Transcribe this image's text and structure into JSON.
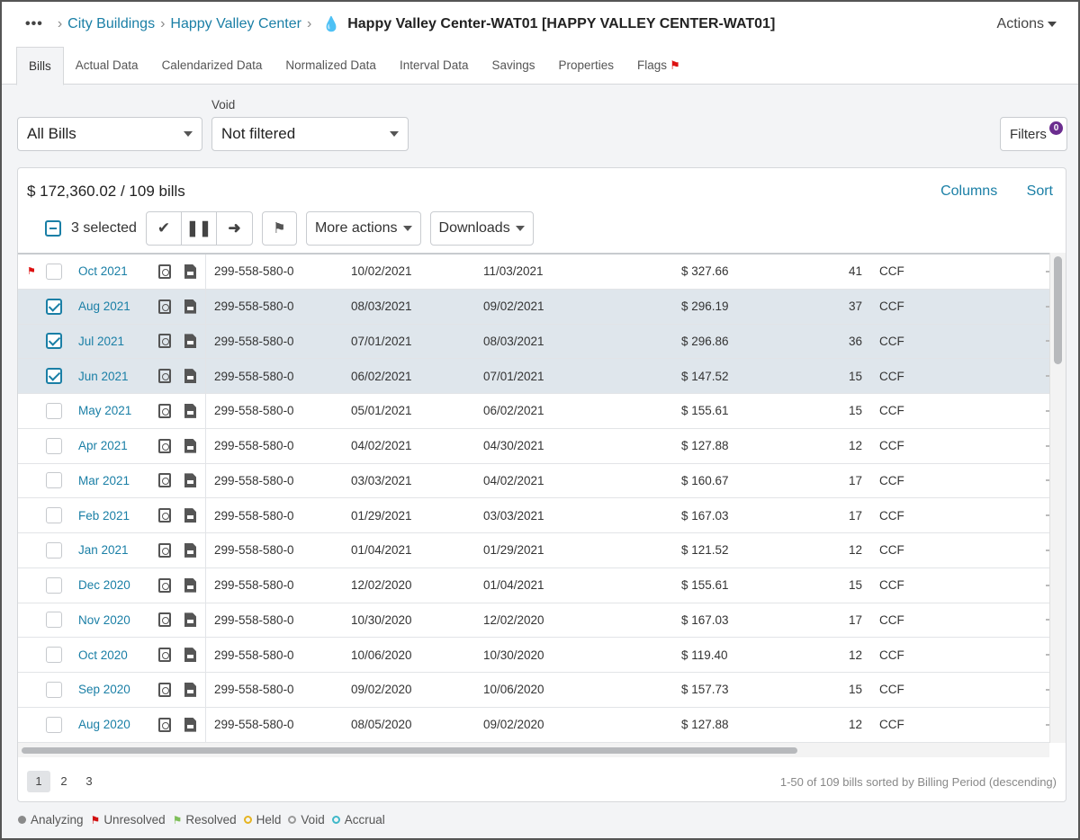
{
  "header": {
    "breadcrumb": [
      "City Buildings",
      "Happy Valley Center"
    ],
    "title": "Happy Valley Center-WAT01 [HAPPY VALLEY CENTER-WAT01]",
    "actions_label": "Actions"
  },
  "tabs": [
    "Bills",
    "Actual Data",
    "Calendarized Data",
    "Normalized Data",
    "Interval Data",
    "Savings",
    "Properties",
    "Flags"
  ],
  "filters": {
    "bills_select": "All Bills",
    "void_label": "Void",
    "void_select": "Not filtered",
    "filters_button": "Filters",
    "filters_count": "0"
  },
  "panel": {
    "summary": "$ 172,360.02 / 109 bills",
    "columns_link": "Columns",
    "sort_link": "Sort",
    "selected_text": "3 selected",
    "more_actions": "More actions",
    "downloads": "Downloads"
  },
  "rows": [
    {
      "period": "Oct 2021",
      "account": "299-558-580-0",
      "start": "10/02/2021",
      "end": "11/03/2021",
      "cost": "$ 327.66",
      "use": "41",
      "unit": "CCF",
      "flag": "⚑",
      "selected": false
    },
    {
      "period": "Aug 2021",
      "account": "299-558-580-0",
      "start": "08/03/2021",
      "end": "09/02/2021",
      "cost": "$ 296.19",
      "use": "37",
      "unit": "CCF",
      "flag": "",
      "selected": true
    },
    {
      "period": "Jul 2021",
      "account": "299-558-580-0",
      "start": "07/01/2021",
      "end": "08/03/2021",
      "cost": "$ 296.86",
      "use": "36",
      "unit": "CCF",
      "flag": "",
      "selected": true
    },
    {
      "period": "Jun 2021",
      "account": "299-558-580-0",
      "start": "06/02/2021",
      "end": "07/01/2021",
      "cost": "$ 147.52",
      "use": "15",
      "unit": "CCF",
      "flag": "",
      "selected": true
    },
    {
      "period": "May 2021",
      "account": "299-558-580-0",
      "start": "05/01/2021",
      "end": "06/02/2021",
      "cost": "$ 155.61",
      "use": "15",
      "unit": "CCF",
      "flag": "",
      "selected": false
    },
    {
      "period": "Apr 2021",
      "account": "299-558-580-0",
      "start": "04/02/2021",
      "end": "04/30/2021",
      "cost": "$ 127.88",
      "use": "12",
      "unit": "CCF",
      "flag": "",
      "selected": false
    },
    {
      "period": "Mar 2021",
      "account": "299-558-580-0",
      "start": "03/03/2021",
      "end": "04/02/2021",
      "cost": "$ 160.67",
      "use": "17",
      "unit": "CCF",
      "flag": "",
      "selected": false
    },
    {
      "period": "Feb 2021",
      "account": "299-558-580-0",
      "start": "01/29/2021",
      "end": "03/03/2021",
      "cost": "$ 167.03",
      "use": "17",
      "unit": "CCF",
      "flag": "",
      "selected": false
    },
    {
      "period": "Jan 2021",
      "account": "299-558-580-0",
      "start": "01/04/2021",
      "end": "01/29/2021",
      "cost": "$ 121.52",
      "use": "12",
      "unit": "CCF",
      "flag": "",
      "selected": false
    },
    {
      "period": "Dec 2020",
      "account": "299-558-580-0",
      "start": "12/02/2020",
      "end": "01/04/2021",
      "cost": "$ 155.61",
      "use": "15",
      "unit": "CCF",
      "flag": "",
      "selected": false
    },
    {
      "period": "Nov 2020",
      "account": "299-558-580-0",
      "start": "10/30/2020",
      "end": "12/02/2020",
      "cost": "$ 167.03",
      "use": "17",
      "unit": "CCF",
      "flag": "",
      "selected": false
    },
    {
      "period": "Oct 2020",
      "account": "299-558-580-0",
      "start": "10/06/2020",
      "end": "10/30/2020",
      "cost": "$ 119.40",
      "use": "12",
      "unit": "CCF",
      "flag": "",
      "selected": false
    },
    {
      "period": "Sep 2020",
      "account": "299-558-580-0",
      "start": "09/02/2020",
      "end": "10/06/2020",
      "cost": "$ 157.73",
      "use": "15",
      "unit": "CCF",
      "flag": "",
      "selected": false
    },
    {
      "period": "Aug 2020",
      "account": "299-558-580-0",
      "start": "08/05/2020",
      "end": "09/02/2020",
      "cost": "$ 127.88",
      "use": "12",
      "unit": "CCF",
      "flag": "",
      "selected": false
    }
  ],
  "pagination": {
    "pages": [
      "1",
      "2",
      "3"
    ],
    "current": "1",
    "info": "1-50 of 109 bills sorted by Billing Period (descending)"
  },
  "legend": [
    {
      "label": "Analyzing",
      "kind": "dot",
      "color": "#8a8a8a",
      "icon": "dot-icon"
    },
    {
      "label": "Unresolved",
      "kind": "flag",
      "color": "#d11111",
      "icon": "flag-icon"
    },
    {
      "label": "Resolved",
      "kind": "flag",
      "color": "#7fbf5a",
      "icon": "flag-icon"
    },
    {
      "label": "Held",
      "kind": "ring",
      "color": "#e6b422",
      "icon": "ring-icon"
    },
    {
      "label": "Void",
      "kind": "ring",
      "color": "#9a9a9a",
      "icon": "ring-icon"
    },
    {
      "label": "Accrual",
      "kind": "ring",
      "color": "#3fb8c9",
      "icon": "ring-icon"
    }
  ],
  "colors": {
    "link": "#1a7fa6",
    "flag": "#d11111",
    "selected_row": "#dfe6ec"
  }
}
